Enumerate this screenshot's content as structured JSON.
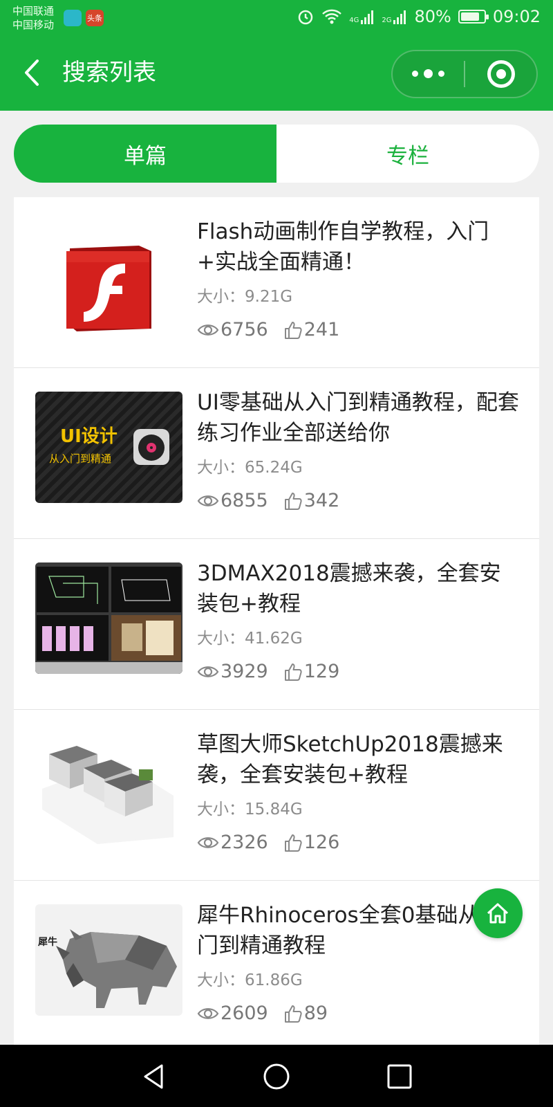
{
  "status_bar": {
    "carrier_1": "中国联通",
    "carrier_2": "中国移动",
    "news_badge": "头条",
    "signal_1_label": "4G",
    "signal_2_label": "2G",
    "battery": "80%",
    "battery_level": 0.8,
    "time": "09:02"
  },
  "nav": {
    "title": "搜索列表"
  },
  "tabs": [
    {
      "label": "单篇",
      "active": true
    },
    {
      "label": "专栏",
      "active": false
    }
  ],
  "items": [
    {
      "title": "Flash动画制作自学教程，入门+实战全面精通！",
      "size": "大小：9.21G",
      "views": "6756",
      "likes": "241",
      "thumb": "flash-logo"
    },
    {
      "title": "UI零基础从入门到精通教程，配套练习作业全部送给你",
      "size": "大小：65.24G",
      "views": "6855",
      "likes": "342",
      "thumb": "ui-design-banner",
      "thumb_text_1": "UI设计",
      "thumb_text_2": "从入门到精通"
    },
    {
      "title": "3DMAX2018震撼来袭，全套安装包+教程",
      "size": "大小：41.62G",
      "views": "3929",
      "likes": "129",
      "thumb": "3dmax-viewports"
    },
    {
      "title": "草图大师SketchUp2018震撼来袭，全套安装包+教程",
      "size": "大小：15.84G",
      "views": "2326",
      "likes": "126",
      "thumb": "sketchup-house-model"
    },
    {
      "title": "犀牛Rhinoceros全套0基础从入门到精通教程",
      "size": "大小：61.86G",
      "views": "2609",
      "likes": "89",
      "thumb": "rhino-lowpoly",
      "thumb_text_1": "犀牛"
    }
  ],
  "colors": {
    "primary": "#18b33e",
    "text": "#222222",
    "muted": "#8c8c8c"
  }
}
